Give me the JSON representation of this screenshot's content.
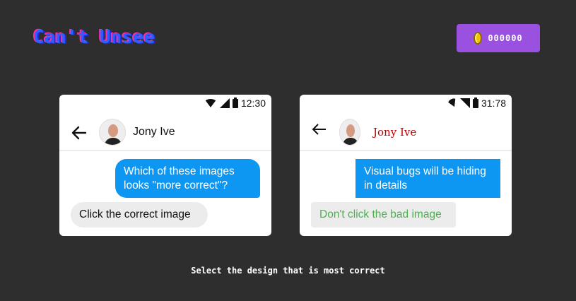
{
  "logo": {
    "text": "Can't Unsee"
  },
  "coins": {
    "count": "000000",
    "icon": "coin-icon"
  },
  "instruction": "Select the design that is most correct",
  "cards": [
    {
      "status_time": "12:30",
      "contact_name": "Jony Ive",
      "outgoing_message": "Which of these images looks \"more correct\"?",
      "incoming_message": "Click the correct image"
    },
    {
      "status_time": "31:78",
      "contact_name": "Jony Ive",
      "outgoing_message": "Visual bugs will be hiding in details",
      "incoming_message": "Don't click the bad image"
    }
  ],
  "colors": {
    "background": "#2e2e2e",
    "badge": "#9b51e0",
    "outgoing_bubble": "#0d96f2",
    "incoming_bubble": "#ececec",
    "wrong_name": "#c00000",
    "wrong_message": "#4caf50"
  }
}
